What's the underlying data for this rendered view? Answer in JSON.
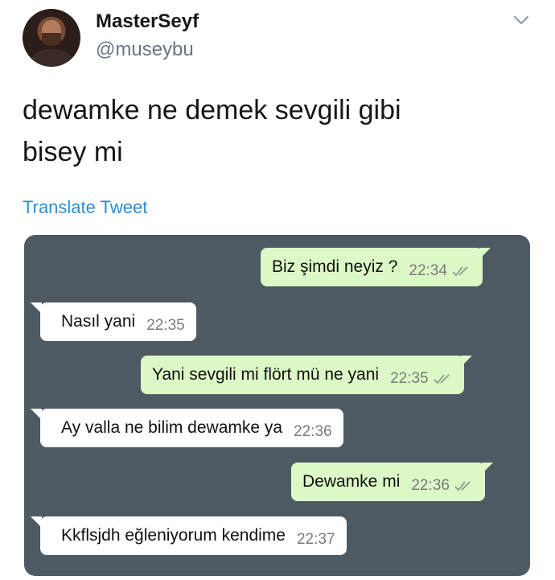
{
  "tweet": {
    "display_name": "MasterSeyf",
    "handle": "@museybu",
    "text_line1": "dewamke ne demek sevgili gibi",
    "text_line2": "bisey mi",
    "translate_label": "Translate Tweet",
    "menu_icon": "chevron-down-icon"
  },
  "chat": {
    "messages": [
      {
        "direction": "out",
        "text": "Biz şimdi neyiz ?",
        "time": "22:34",
        "status": "double-check-icon"
      },
      {
        "direction": "in",
        "text": "Nasıl yani",
        "time": "22:35"
      },
      {
        "direction": "out",
        "text": "Yani sevgili mi flört mü ne yani",
        "time": "22:35",
        "status": "double-check-icon"
      },
      {
        "direction": "in",
        "text": "Ay valla ne bilim dewamke ya",
        "time": "22:36"
      },
      {
        "direction": "out",
        "text": "Dewamke mi",
        "time": "22:36",
        "status": "double-check-icon"
      },
      {
        "direction": "in",
        "text": "Kkflsjdh eğleniyorum kendime",
        "time": "22:37"
      }
    ]
  },
  "colors": {
    "link": "#2b8fd6",
    "chat_background": "#4e5a63",
    "outgoing_bubble": "#dcf8c6",
    "incoming_bubble": "#ffffff"
  }
}
